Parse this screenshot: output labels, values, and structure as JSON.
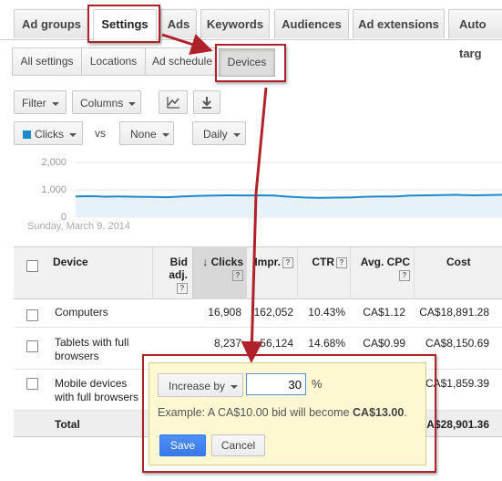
{
  "tabs": [
    {
      "label": "Ad groups"
    },
    {
      "label": "Settings",
      "active": true
    },
    {
      "label": "Ads"
    },
    {
      "label": "Keywords"
    },
    {
      "label": "Audiences"
    },
    {
      "label": "Ad extensions"
    },
    {
      "label": "Auto targ"
    }
  ],
  "subtabs": [
    {
      "label": "All settings"
    },
    {
      "label": "Locations"
    },
    {
      "label": "Ad schedule"
    },
    {
      "label": "Devices",
      "active": true
    }
  ],
  "toolbar": {
    "filter_label": "Filter",
    "columns_label": "Columns",
    "metric_label": "Clicks",
    "metric_color": "#1e88c8",
    "vs_label": "vs",
    "compare_label": "None",
    "interval_label": "Daily",
    "chart_icon": "line-chart-icon",
    "download_icon": "download-icon"
  },
  "chart": {
    "y_ticks": [
      "2,000",
      "1,000",
      "0"
    ],
    "date_label": "Sunday, March 9, 2014",
    "line_color": "#1e88c8",
    "fill_color": "#e6f2f8"
  },
  "chart_data": {
    "type": "area",
    "series": [
      {
        "name": "Clicks",
        "values": [
          760,
          770,
          750,
          760,
          745,
          740,
          730,
          760,
          780,
          790,
          800,
          795,
          800,
          790,
          750,
          720,
          710,
          715,
          720,
          745,
          760,
          760,
          790,
          800,
          810,
          820,
          800,
          810,
          820
        ]
      }
    ],
    "ylim": [
      0,
      2000
    ],
    "y_ticks": [
      0,
      1000,
      2000
    ],
    "xlabel": "Sunday, March 9, 2014"
  },
  "table": {
    "headers": {
      "device": "Device",
      "bid_adj": "Bid adj.",
      "clicks": "Clicks",
      "clicks_sort": "↓",
      "impr": "Impr.",
      "ctr": "CTR",
      "avg_cpc": "Avg. CPC",
      "cost": "Cost",
      "help": "?"
    },
    "rows": [
      {
        "device": "Computers",
        "clicks": "16,908",
        "impr": "162,052",
        "ctr": "10.43%",
        "avg_cpc": "CA$1.12",
        "cost": "CA$18,891.28"
      },
      {
        "device": "Tablets with full browsers",
        "clicks": "8,237",
        "impr": "56,124",
        "ctr": "14.68%",
        "avg_cpc": "CA$0.99",
        "cost": "CA$8,150.69"
      },
      {
        "device": "Mobile devices with full browsers",
        "clicks": "",
        "impr": "",
        "ctr": "",
        "avg_cpc": "",
        "cost": "CA$1,859.39"
      }
    ],
    "total": {
      "label": "Total",
      "cost": "CA$28,901.36"
    }
  },
  "popup": {
    "mode_label": "Increase by",
    "value": "30",
    "unit": "%",
    "example_prefix": "Example: A CA$10.00 bid will become ",
    "example_result": "CA$13.00",
    "example_suffix": ".",
    "save_label": "Save",
    "cancel_label": "Cancel"
  },
  "annotation_color": "#b0222a"
}
